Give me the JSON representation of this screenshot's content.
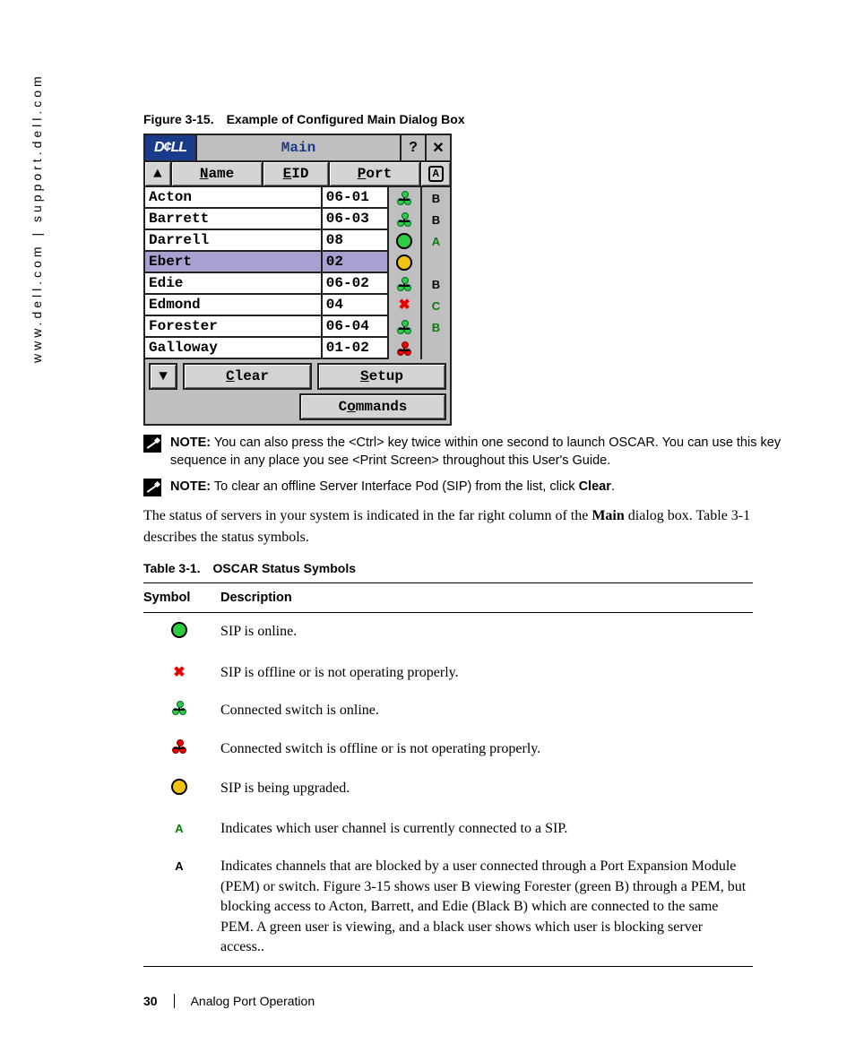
{
  "side_url": "www.dell.com | support.dell.com",
  "figure": {
    "label": "Figure 3-15.",
    "title": "Example of Configured Main Dialog Box"
  },
  "dialog": {
    "logo": "D¢LL",
    "title": "Main",
    "headers": {
      "name": "Name",
      "eid": "EID",
      "port": "Port"
    },
    "buttons": {
      "clear": "Clear",
      "setup": "Setup",
      "commands": "Commands"
    },
    "rows": [
      {
        "name": "Acton",
        "port": "06-01",
        "status": "tree-green",
        "chan": "B",
        "chan_color": "black",
        "selected": false
      },
      {
        "name": "Barrett",
        "port": "06-03",
        "status": "tree-green",
        "chan": "B",
        "chan_color": "black",
        "selected": false
      },
      {
        "name": "Darrell",
        "port": "08",
        "status": "circle-green",
        "chan": "A",
        "chan_color": "green",
        "selected": false
      },
      {
        "name": "Ebert",
        "port": "02",
        "status": "circle-yellow",
        "chan": "",
        "chan_color": "",
        "selected": true
      },
      {
        "name": "Edie",
        "port": "06-02",
        "status": "tree-green",
        "chan": "B",
        "chan_color": "black",
        "selected": false
      },
      {
        "name": "Edmond",
        "port": "04",
        "status": "x-red",
        "chan": "C",
        "chan_color": "green",
        "selected": false
      },
      {
        "name": "Forester",
        "port": "06-04",
        "status": "tree-green",
        "chan": "B",
        "chan_color": "green",
        "selected": false
      },
      {
        "name": "Galloway",
        "port": "01-02",
        "status": "tree-red",
        "chan": "",
        "chan_color": "",
        "selected": false
      }
    ]
  },
  "notes": [
    {
      "label": "NOTE:",
      "text": " You can also press the <Ctrl> key twice within one second to launch OSCAR. You can use this key sequence in any place you see <Print Screen> throughout this User's Guide."
    },
    {
      "label": "NOTE:",
      "text_pre": " To clear an offline Server Interface Pod (SIP) from the list, click ",
      "bold": "Clear",
      "text_post": "."
    }
  ],
  "paragraph": {
    "pre": "The status of servers in your system is indicated in the far right column of the ",
    "bold": "Main",
    "post": " dialog box. Table 3-1 describes the status symbols."
  },
  "table": {
    "label": "Table 3-1.",
    "title": "OSCAR Status Symbols",
    "col_symbol": "Symbol",
    "col_desc": "Description",
    "rows": [
      {
        "icon": "circle-green",
        "desc": "SIP is online."
      },
      {
        "icon": "x-red",
        "desc": "SIP is offline or is not operating properly."
      },
      {
        "icon": "tree-green",
        "desc": "Connected switch is online."
      },
      {
        "icon": "tree-red",
        "desc": "Connected switch is offline or is not operating properly."
      },
      {
        "icon": "circle-yellow",
        "desc": "SIP is being upgraded."
      },
      {
        "icon": "a-green",
        "desc": "Indicates which user channel is currently connected to a SIP."
      },
      {
        "icon": "a-black",
        "desc": "Indicates channels that are blocked by a user connected through a Port Expansion Module (PEM) or switch. Figure 3-15 shows user B viewing Forester (green B) through a PEM, but blocking access to Acton, Barrett, and Edie (Black B) which are connected to the same PEM. A green user is viewing, and a black user shows which user is blocking server access.."
      }
    ]
  },
  "footer": {
    "page": "30",
    "section": "Analog Port Operation"
  }
}
